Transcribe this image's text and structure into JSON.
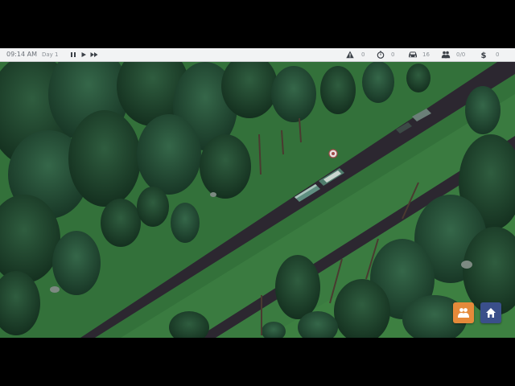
{
  "hud": {
    "time": "09:14 AM",
    "day": "Day 1",
    "controls": {
      "pause_icon": "pause-icon",
      "play_icon": "play-icon",
      "fast_forward_icon": "fast-forward-icon"
    },
    "stats": {
      "warnings": "0",
      "timer": "0",
      "vehicles": "16",
      "passengers": "0/0",
      "money": "0"
    }
  },
  "buttons": {
    "passengers_icon": "passengers-icon",
    "home_icon": "home-icon"
  },
  "colors": {
    "hud_bg": "#f2f3f4",
    "grass": "#3a7a3f",
    "road": "#2c2730",
    "orange_button": "#e58a3a",
    "blue_button": "#3a4f8a"
  }
}
